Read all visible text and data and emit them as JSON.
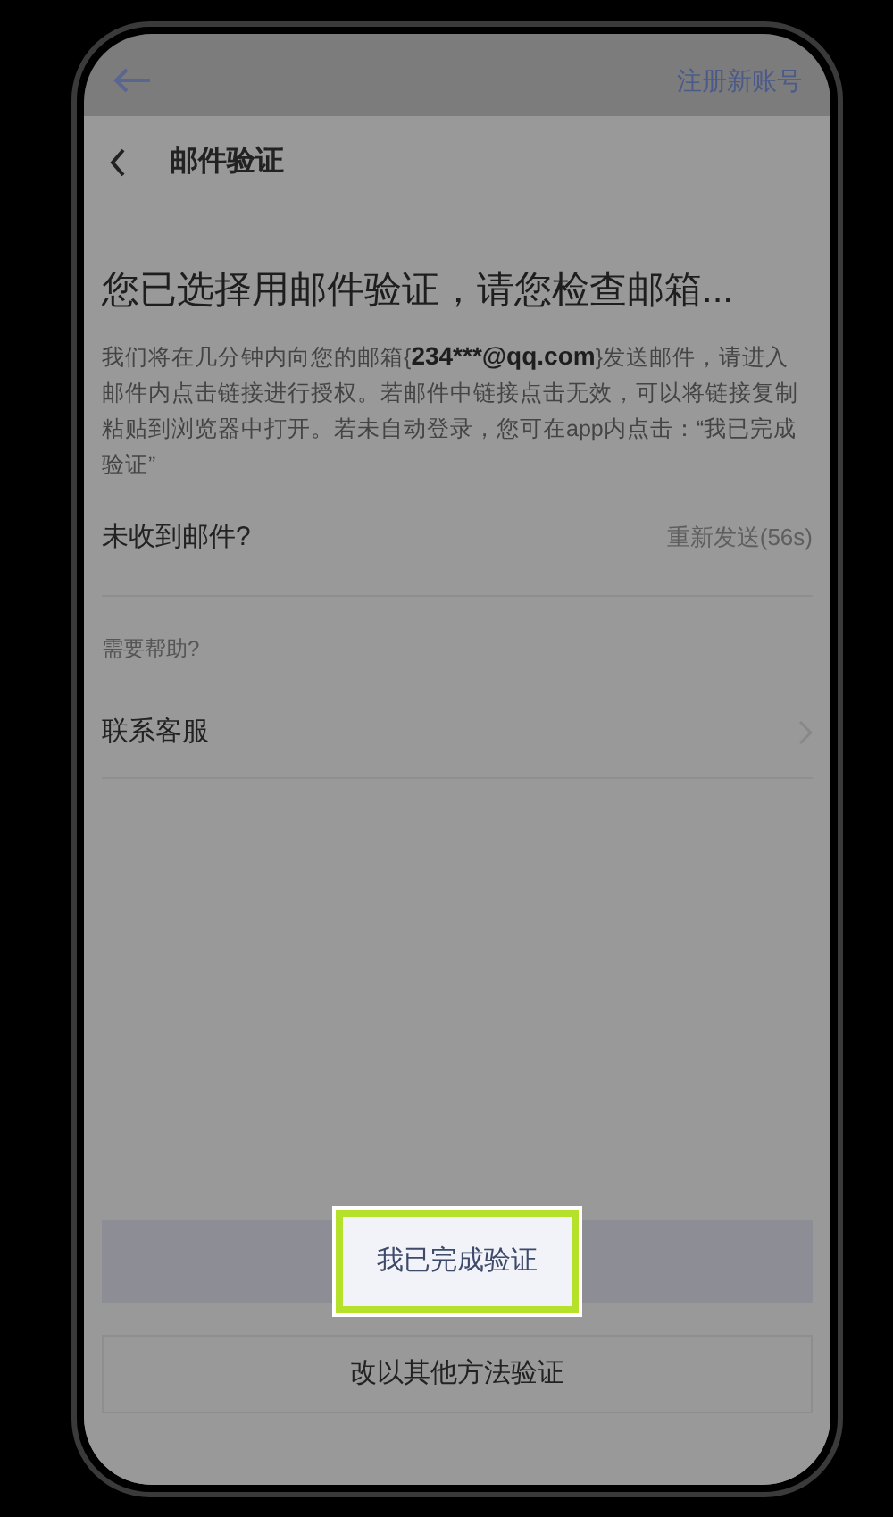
{
  "top_bar": {
    "link": "注册新账号"
  },
  "header": {
    "title": "邮件验证"
  },
  "heading": "您已选择用邮件验证，请您检查邮箱...",
  "body": {
    "before": "我们将在几分钟内向您的邮箱{",
    "email": "234***@qq.com",
    "after": "}发送邮件，请进入邮件内点击链接进行授权。若邮件中链接点击无效，可以将链接复制粘贴到浏览器中打开。若未自动登录，您可在app内点击：“我已完成验证”"
  },
  "resend": {
    "label": "未收到邮件?",
    "action": "重新发送(56s)"
  },
  "help_label": "需要帮助?",
  "contact": {
    "label": "联系客服"
  },
  "primary_button": {
    "label": "我已完成验证",
    "highlighted": true
  },
  "secondary_button": {
    "label": "改以其他方法验证"
  }
}
